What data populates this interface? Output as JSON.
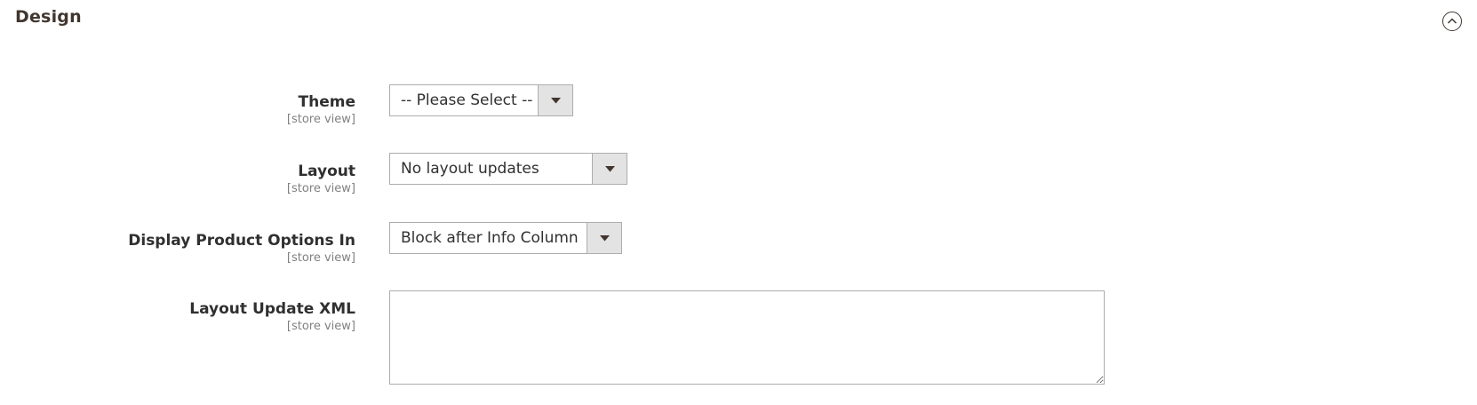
{
  "section": {
    "title": "Design",
    "collapse_icon": "chevron-up-circle-icon"
  },
  "fields": {
    "theme": {
      "label": "Theme",
      "scope": "[store view]",
      "value": "-- Please Select --"
    },
    "layout": {
      "label": "Layout",
      "scope": "[store view]",
      "value": "No layout updates"
    },
    "display_options": {
      "label": "Display Product Options In",
      "scope": "[store view]",
      "value": "Block after Info Column"
    },
    "layout_xml": {
      "label": "Layout Update XML",
      "scope": "[store view]",
      "value": ""
    }
  },
  "colors": {
    "title": "#41362f",
    "label": "#303030",
    "scope": "#808080",
    "border": "#adadad",
    "select_button": "#e3e3e3"
  }
}
